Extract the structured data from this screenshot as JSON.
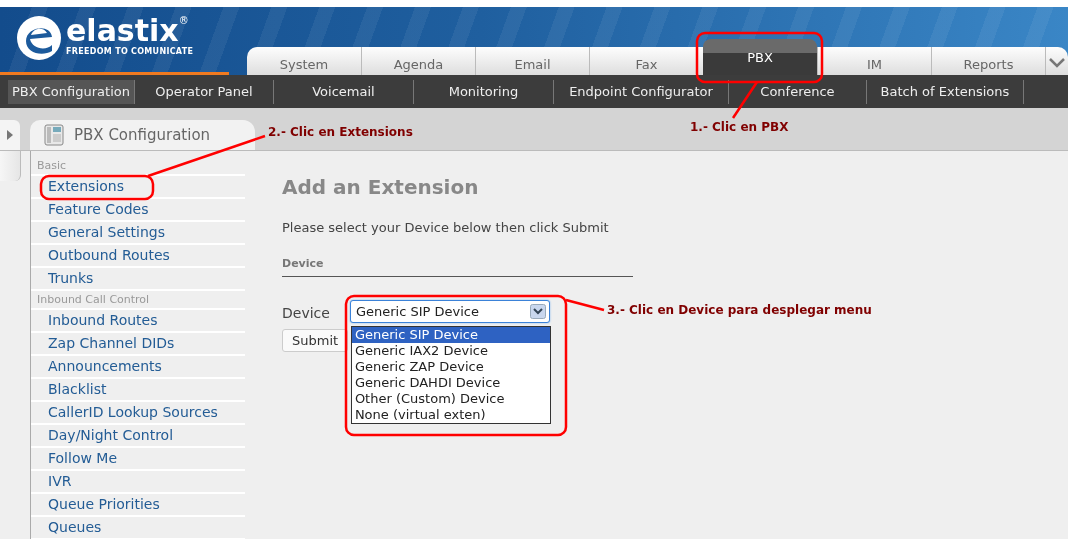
{
  "header": {
    "logo": {
      "name": "elastix",
      "mark": "®",
      "tagline": "FREEDOM TO COMUNICATE"
    },
    "tabs": [
      {
        "label": "System",
        "selected": false
      },
      {
        "label": "Agenda",
        "selected": false
      },
      {
        "label": "Email",
        "selected": false
      },
      {
        "label": "Fax",
        "selected": false
      },
      {
        "label": "PBX",
        "selected": true
      },
      {
        "label": "IM",
        "selected": false
      },
      {
        "label": "Reports",
        "selected": false
      }
    ]
  },
  "subnav": [
    {
      "label": "PBX Configuration",
      "selected": true
    },
    {
      "label": "Operator Panel",
      "selected": false
    },
    {
      "label": "Voicemail",
      "selected": false
    },
    {
      "label": "Monitoring",
      "selected": false
    },
    {
      "label": "Endpoint Configurator",
      "selected": false
    },
    {
      "label": "Conference",
      "selected": false
    },
    {
      "label": "Batch of Extensions",
      "selected": false
    }
  ],
  "panel_tab": {
    "title": "PBX Configuration"
  },
  "sidebar": {
    "groups": [
      {
        "heading": "Basic",
        "items": [
          "Extensions",
          "Feature Codes",
          "General Settings",
          "Outbound Routes",
          "Trunks"
        ]
      },
      {
        "heading": "Inbound Call Control",
        "items": [
          "Inbound Routes",
          "Zap Channel DIDs",
          "Announcements",
          "Blacklist",
          "CallerID Lookup Sources",
          "Day/Night Control",
          "Follow Me",
          "IVR",
          "Queue Priorities",
          "Queues"
        ]
      }
    ]
  },
  "form": {
    "title": "Add an Extension",
    "instruction": "Please select your Device below then click Submit",
    "section": "Device",
    "device": {
      "label": "Device",
      "value": "Generic SIP Device",
      "expanded": true,
      "options": [
        {
          "label": "Generic SIP Device",
          "selected": true
        },
        {
          "label": "Generic IAX2 Device",
          "selected": false
        },
        {
          "label": "Generic ZAP Device",
          "selected": false
        },
        {
          "label": "Generic DAHDI Device",
          "selected": false
        },
        {
          "label": "Other (Custom) Device",
          "selected": false
        },
        {
          "label": "None (virtual exten)",
          "selected": false
        }
      ]
    },
    "submit": "Submit"
  },
  "annotations": [
    {
      "text": "1.- Clic en PBX"
    },
    {
      "text": "2.- Clic en Extensions"
    },
    {
      "text": "3.- Clic en Device para desplegar menu"
    }
  ]
}
